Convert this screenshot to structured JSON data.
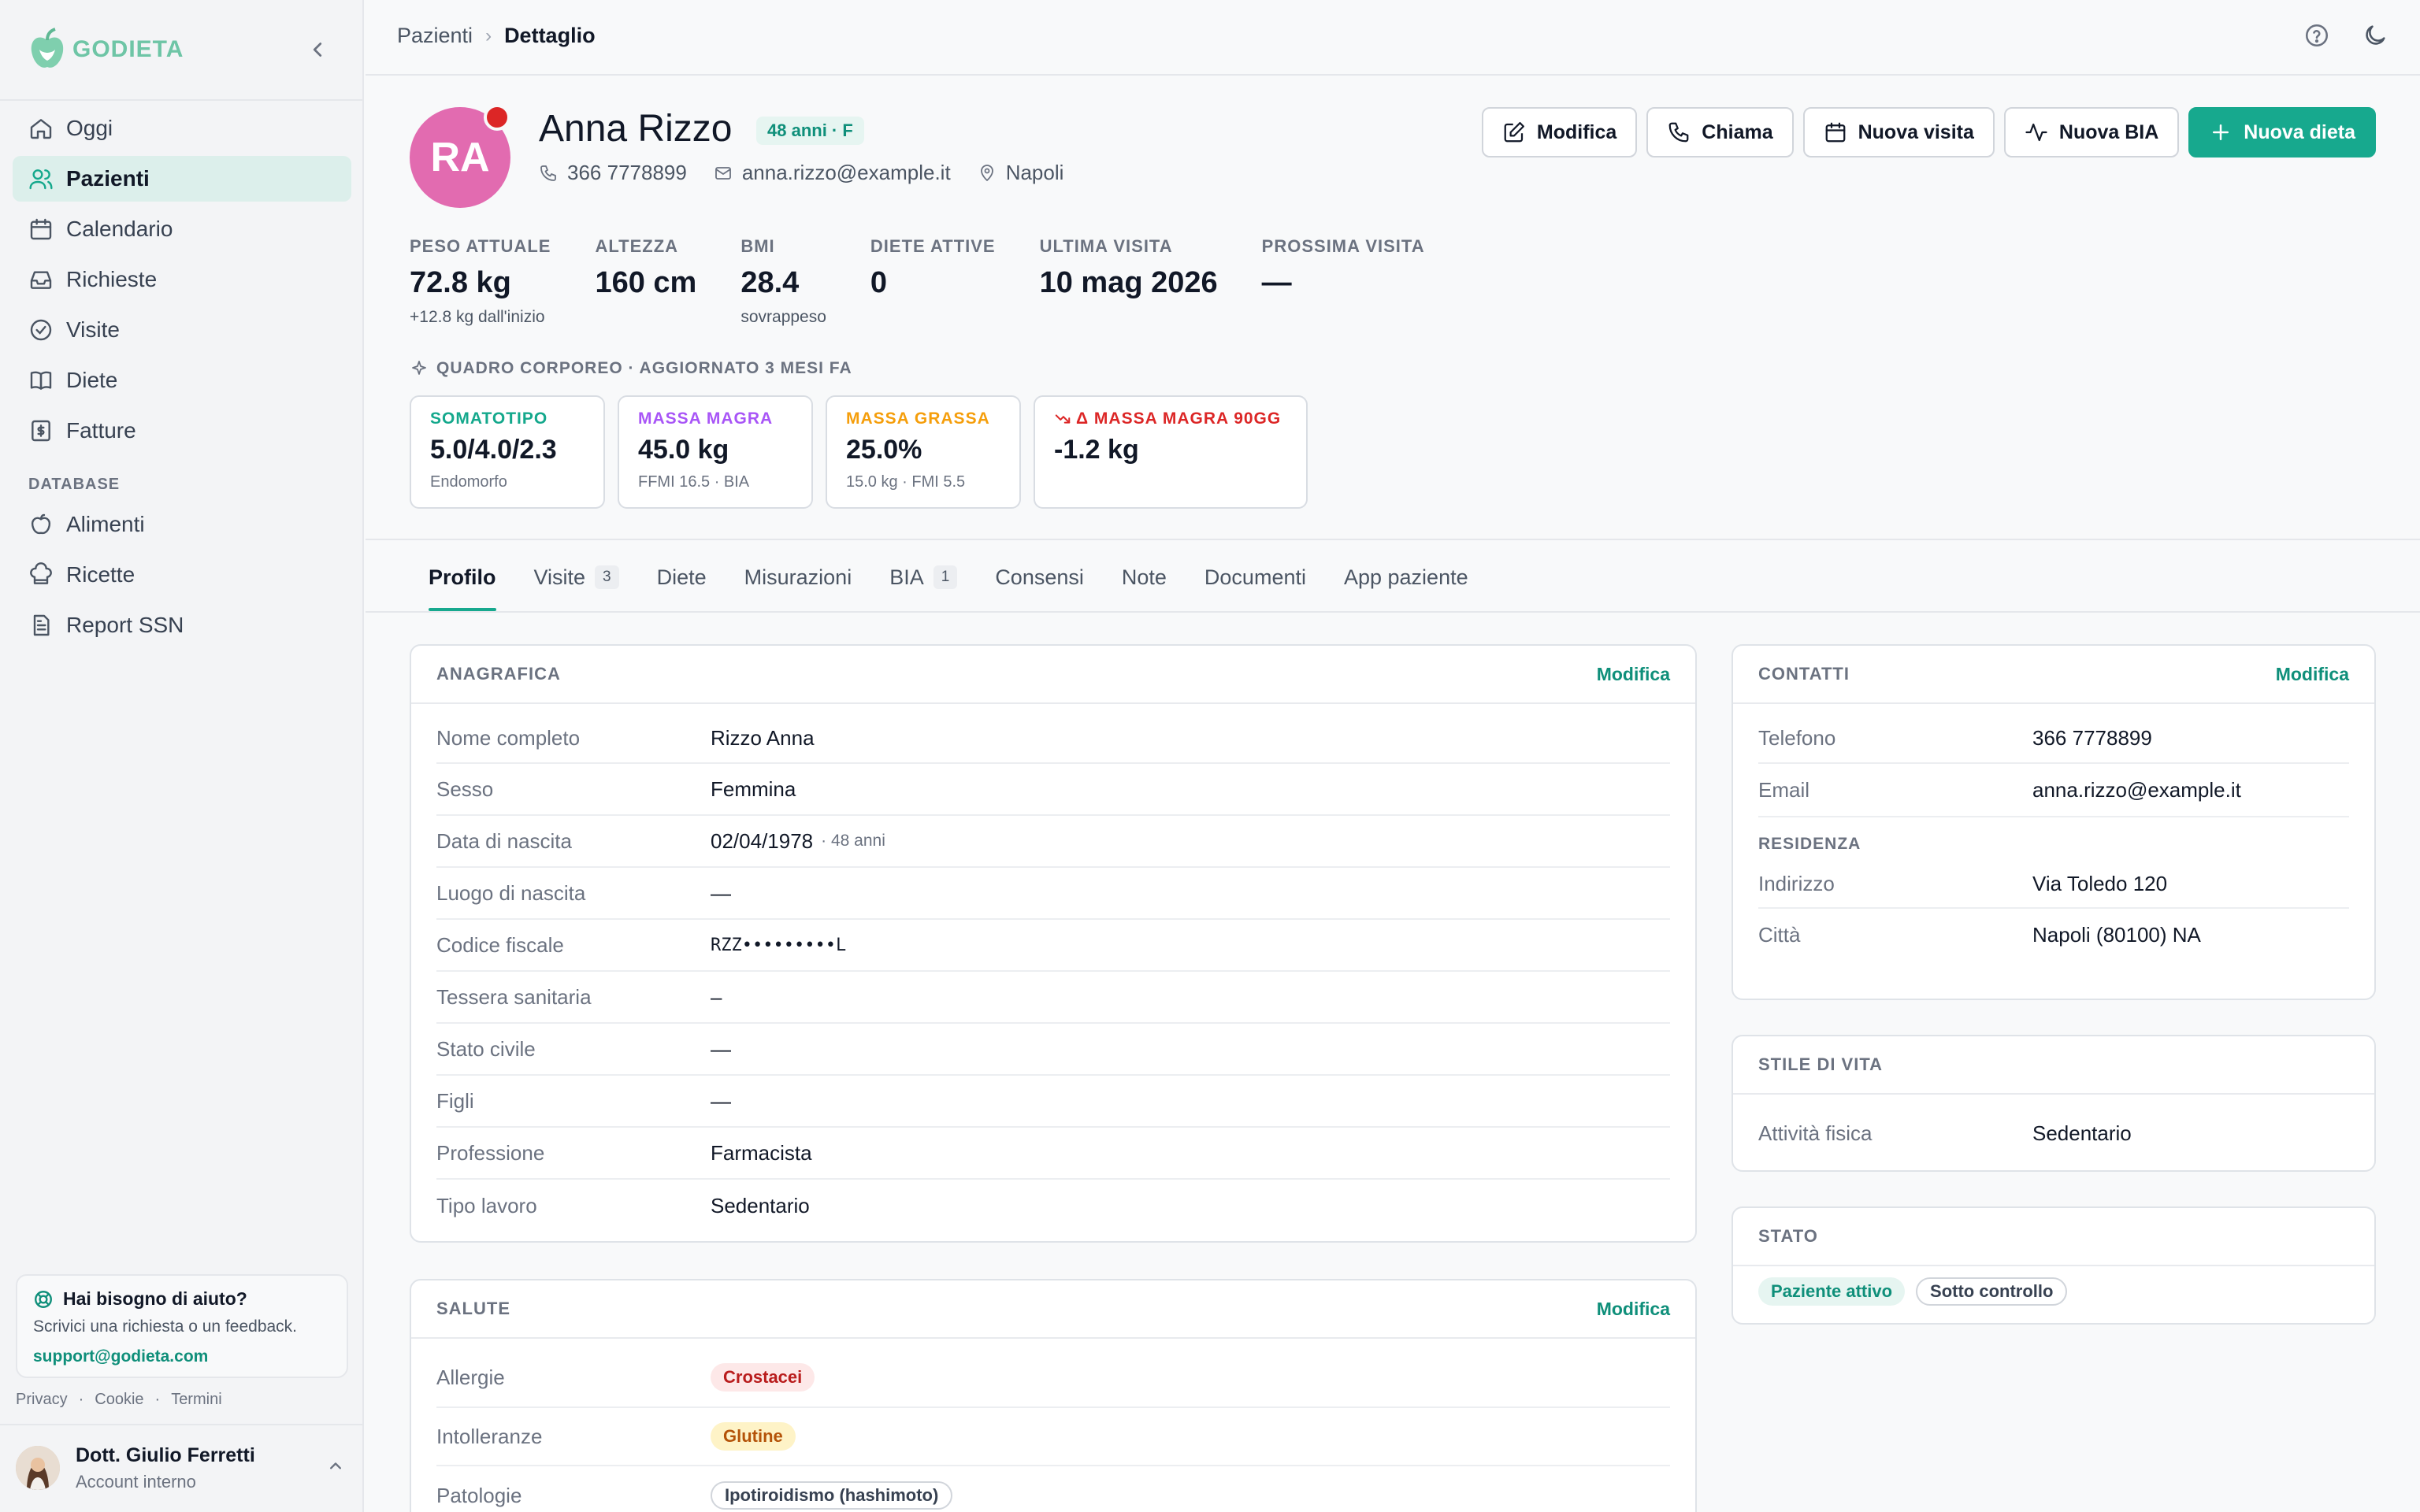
{
  "app": {
    "name": "GODIETA"
  },
  "sidebar": {
    "items": [
      {
        "label": "Oggi",
        "icon": "home-icon"
      },
      {
        "label": "Pazienti",
        "icon": "users-icon",
        "active": true
      },
      {
        "label": "Calendario",
        "icon": "calendar-icon"
      },
      {
        "label": "Richieste",
        "icon": "inbox-icon"
      },
      {
        "label": "Visite",
        "icon": "check-circle-icon"
      },
      {
        "label": "Diete",
        "icon": "book-icon"
      },
      {
        "label": "Fatture",
        "icon": "invoice-icon"
      }
    ],
    "database_label": "DATABASE",
    "database_items": [
      {
        "label": "Alimenti",
        "icon": "apple-icon"
      },
      {
        "label": "Ricette",
        "icon": "chef-hat-icon"
      },
      {
        "label": "Report SSN",
        "icon": "report-icon"
      }
    ],
    "help": {
      "title": "Hai bisogno di aiuto?",
      "text": "Scrivici una richiesta o un feedback.",
      "email": "support@godieta.com"
    },
    "legal": [
      "Privacy",
      "Cookie",
      "Termini"
    ],
    "legal_sep": "·",
    "user": {
      "name": "Dott. Giulio Ferretti",
      "role": "Account interno"
    }
  },
  "breadcrumb": {
    "parent": "Pazienti",
    "sep": "›",
    "current": "Dettaglio"
  },
  "patient": {
    "initials": "RA",
    "name": "Anna Rizzo",
    "age_badge": "48 anni · F",
    "phone": "366 7778899",
    "email": "anna.rizzo@example.it",
    "city": "Napoli"
  },
  "actions": {
    "edit": "Modifica",
    "call": "Chiama",
    "new_visit": "Nuova visita",
    "new_bia": "Nuova BIA",
    "new_diet": "Nuova dieta"
  },
  "stats": [
    {
      "label": "PESO ATTUALE",
      "value": "72.8 kg",
      "sub": "+12.8 kg dall'inizio"
    },
    {
      "label": "ALTEZZA",
      "value": "160 cm",
      "sub": ""
    },
    {
      "label": "BMI",
      "value": "28.4",
      "sub": "sovrappeso"
    },
    {
      "label": "DIETE ATTIVE",
      "value": "0",
      "sub": ""
    },
    {
      "label": "ULTIMA VISITA",
      "value": "10 mag 2026",
      "sub": ""
    },
    {
      "label": "PROSSIMA VISITA",
      "value": "—",
      "sub": ""
    }
  ],
  "body_composition": {
    "title": "QUADRO CORPOREO · AGGIORNATO 3 MESI FA",
    "cards": [
      {
        "label": "SOMATOTIPO",
        "value": "5.0/4.0/2.3",
        "sub": "Endomorfo",
        "color": "#14a88c"
      },
      {
        "label": "MASSA MAGRA",
        "value": "45.0 kg",
        "sub": "FFMI 16.5 · BIA",
        "color": "#a855f7"
      },
      {
        "label": "MASSA GRASSA",
        "value": "25.0%",
        "sub": "15.0 kg · FMI 5.5",
        "color": "#f59e0b"
      },
      {
        "label": "Δ MASSA MAGRA 90GG",
        "value": "-1.2 kg",
        "sub": "",
        "color": "#dc2626"
      }
    ]
  },
  "tabs": [
    {
      "label": "Profilo",
      "active": true
    },
    {
      "label": "Visite",
      "count": "3"
    },
    {
      "label": "Diete"
    },
    {
      "label": "Misurazioni"
    },
    {
      "label": "BIA",
      "count": "1"
    },
    {
      "label": "Consensi"
    },
    {
      "label": "Note"
    },
    {
      "label": "Documenti"
    },
    {
      "label": "App paziente"
    }
  ],
  "anagrafica": {
    "title": "ANAGRAFICA",
    "action": "Modifica",
    "rows": [
      {
        "label": "Nome completo",
        "value": "Rizzo Anna"
      },
      {
        "label": "Sesso",
        "value": "Femmina"
      },
      {
        "label": "Data di nascita",
        "value": "02/04/1978",
        "extra": "· 48 anni"
      },
      {
        "label": "Luogo di nascita",
        "value": "—"
      },
      {
        "label": "Codice fiscale",
        "value": "RZZ•••••••••L"
      },
      {
        "label": "Tessera sanitaria",
        "value": "–"
      },
      {
        "label": "Stato civile",
        "value": "—"
      },
      {
        "label": "Figli",
        "value": "—"
      },
      {
        "label": "Professione",
        "value": "Farmacista"
      },
      {
        "label": "Tipo lavoro",
        "value": "Sedentario"
      }
    ]
  },
  "salute": {
    "title": "SALUTE",
    "action": "Modifica",
    "rows": [
      {
        "label": "Allergie",
        "value": "Crostacei"
      },
      {
        "label": "Intolleranze",
        "value": "Glutine"
      },
      {
        "label": "Patologie",
        "value": "Ipotiroidismo (hashimoto)"
      }
    ]
  },
  "contatti": {
    "title": "CONTATTI",
    "action": "Modifica",
    "rows": [
      {
        "label": "Telefono",
        "value": "366 7778899"
      },
      {
        "label": "Email",
        "value": "anna.rizzo@example.it"
      }
    ],
    "residence_title": "RESIDENZA",
    "residence_rows": [
      {
        "label": "Indirizzo",
        "value": "Via Toledo 120"
      },
      {
        "label": "Città",
        "value": "Napoli (80100) NA"
      }
    ]
  },
  "stile_vita": {
    "title": "STILE DI VITA",
    "rows": [
      {
        "label": "Attività fisica",
        "value": "Sedentario"
      }
    ]
  },
  "stato": {
    "title": "STATO",
    "badges": [
      "Paziente attivo",
      "Sotto controllo"
    ]
  }
}
